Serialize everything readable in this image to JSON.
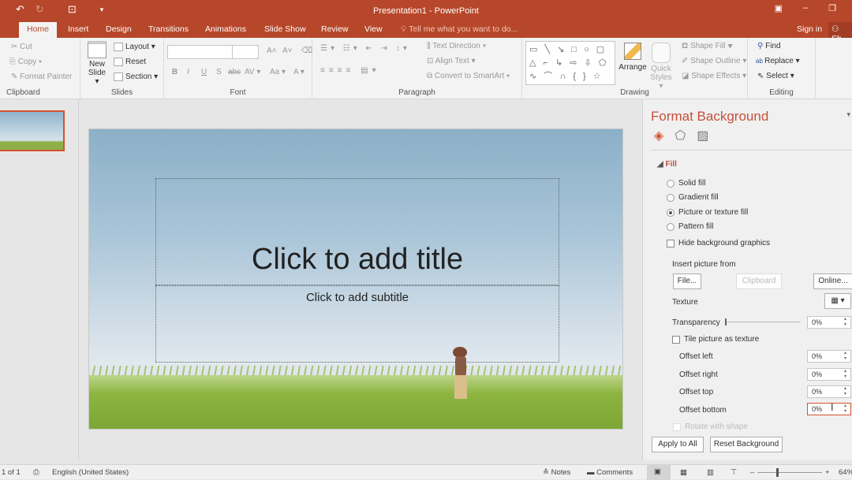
{
  "app": {
    "title": "Presentation1 - PowerPoint",
    "accent": "#b7472a"
  },
  "qat": {
    "undo": "↶",
    "redo": "↻",
    "present": "⊡",
    "customize": "▾"
  },
  "window": {
    "ribbon_display": "▣",
    "minimize": "–",
    "restore": "❐"
  },
  "tabs": [
    {
      "label": "Home",
      "active": true
    },
    {
      "label": "Insert"
    },
    {
      "label": "Design"
    },
    {
      "label": "Transitions"
    },
    {
      "label": "Animations"
    },
    {
      "label": "Slide Show"
    },
    {
      "label": "Review"
    },
    {
      "label": "View"
    }
  ],
  "tell_me": "Tell me what you want to do...",
  "sign_in": "Sign in",
  "share": "Sh",
  "ribbon": {
    "clipboard": {
      "label": "Clipboard",
      "cut": "Cut",
      "copy": "Copy",
      "format_painter": "Format Painter"
    },
    "slides": {
      "label": "Slides",
      "new_slide": "New",
      "new_slide2": "Slide ▾",
      "layout": "Layout ▾",
      "reset": "Reset",
      "section": "Section ▾"
    },
    "font": {
      "label": "Font",
      "bold": "B",
      "italic": "I",
      "underline": "U",
      "strike": "S",
      "shadow": "abc",
      "spacing": "AV ▾",
      "case": "Aa ▾",
      "color": "A ▾",
      "grow": "A˄",
      "shrink": "A˅"
    },
    "paragraph": {
      "label": "Paragraph",
      "text_direction": "Text Direction ▾",
      "align_text": "Align Text ▾",
      "smartart": "Convert to SmartArt ▾"
    },
    "drawing": {
      "label": "Drawing",
      "shapes": "▭ ╲ ↘ □ ○ ▢ △ ⌐ ↳ ⇨ ⇩ ⬠ ∿ ⌒ ∩ { } ☆",
      "arrange": "Arrange",
      "quick_styles": "Quick Styles ▾",
      "shape_fill": "Shape Fill ▾",
      "shape_outline": "Shape Outline ▾",
      "shape_effects": "Shape Effects ▾"
    },
    "editing": {
      "label": "Editing",
      "find": "Find",
      "replace": "Replace ▾",
      "select": "Select ▾"
    }
  },
  "slide": {
    "title_placeholder": "Click to add title",
    "subtitle_placeholder": "Click to add subtitle"
  },
  "pane": {
    "title": "Format Background",
    "fill_header": "Fill",
    "fill_options": [
      {
        "label": "Solid fill",
        "selected": false
      },
      {
        "label": "Gradient fill",
        "selected": false
      },
      {
        "label": "Picture or texture fill",
        "selected": true
      },
      {
        "label": "Pattern fill",
        "selected": false
      }
    ],
    "hide_bg": "Hide background graphics",
    "insert_from": "Insert picture from",
    "file_btn": "File...",
    "clipboard_btn": "Clipboard",
    "online_btn": "Online...",
    "texture": "Texture",
    "transparency": "Transparency",
    "transparency_value": "0%",
    "tile": "Tile picture as texture",
    "offsets": [
      {
        "label": "Offset left",
        "value": "0%"
      },
      {
        "label": "Offset right",
        "value": "0%"
      },
      {
        "label": "Offset top",
        "value": "0%"
      },
      {
        "label": "Offset bottom",
        "value": "0%"
      }
    ],
    "rotate": "Rotate with shape",
    "apply_all": "Apply to All",
    "reset_bg": "Reset Background"
  },
  "status": {
    "slide": "1 of 1",
    "language": "English (United States)",
    "notes": "Notes",
    "comments": "Comments",
    "zoom": "64%"
  }
}
